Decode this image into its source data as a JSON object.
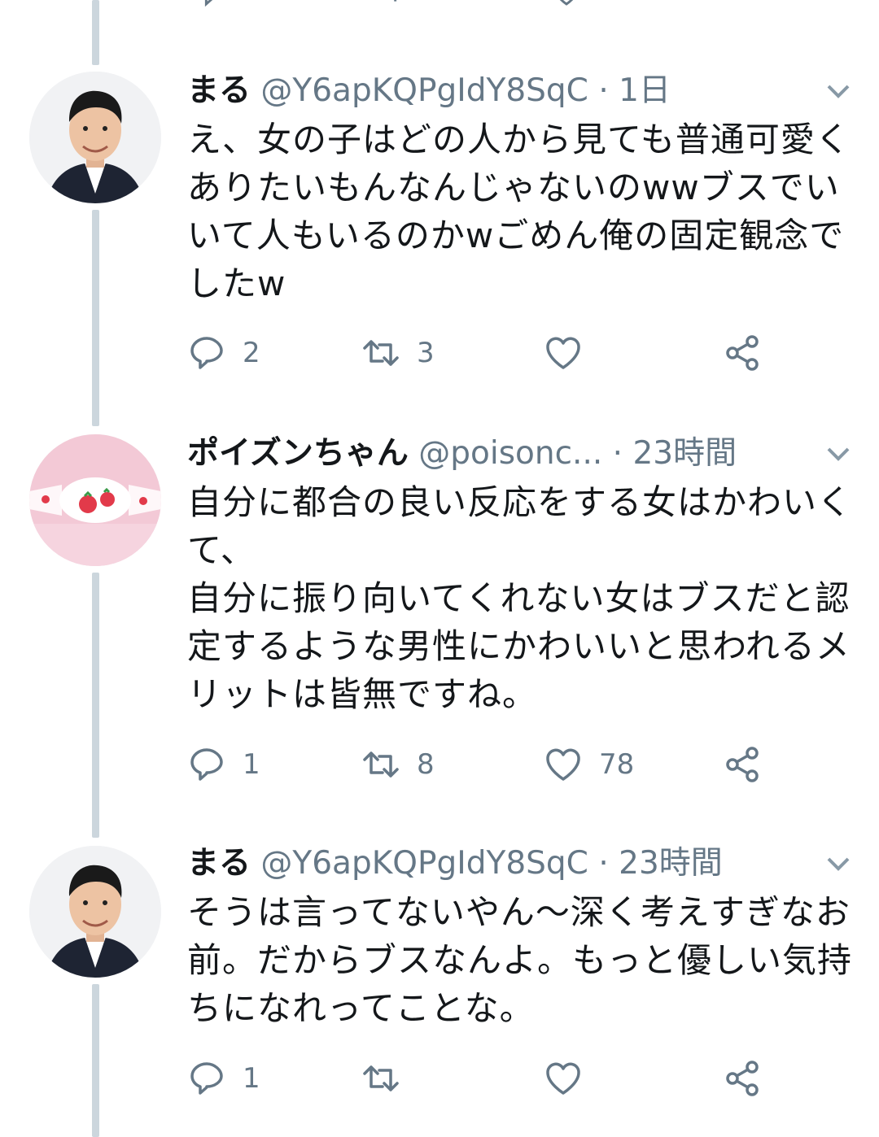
{
  "thread_line_color": "#ccd6dd",
  "icons": {
    "reply": "reply-icon",
    "retweet": "retweet-icon",
    "like": "heart-icon",
    "share": "share-icon",
    "more": "chevron-down-icon"
  },
  "tweets": [
    {
      "name": "まる",
      "handle": "@Y6apKQPgIdY8SqC",
      "dot": "·",
      "time": "1日",
      "text": "え、女の子はどの人から見ても普通可愛くありたいもんなんじゃないのwwブスでいいて人もいるのかwごめん俺の固定観念でしたw",
      "replies": "2",
      "retweets": "3",
      "likes": ""
    },
    {
      "name": "ポイズンちゃん",
      "handle": "@poisonc...",
      "dot": "·",
      "time": "23時間",
      "text": "自分に都合の良い反応をする女はかわいくて、\n自分に振り向いてくれない女はブスだと認定するような男性にかわいいと思われるメリットは皆無ですね。",
      "replies": "1",
      "retweets": "8",
      "likes": "78"
    },
    {
      "name": "まる",
      "handle": "@Y6apKQPgIdY8SqC",
      "dot": "·",
      "time": "23時間",
      "text": "そうは言ってないやん〜深く考えすぎなお前。だからブスなんよ。もっと優しい気持ちになれってことな。",
      "replies": "1",
      "retweets": "",
      "likes": ""
    }
  ]
}
